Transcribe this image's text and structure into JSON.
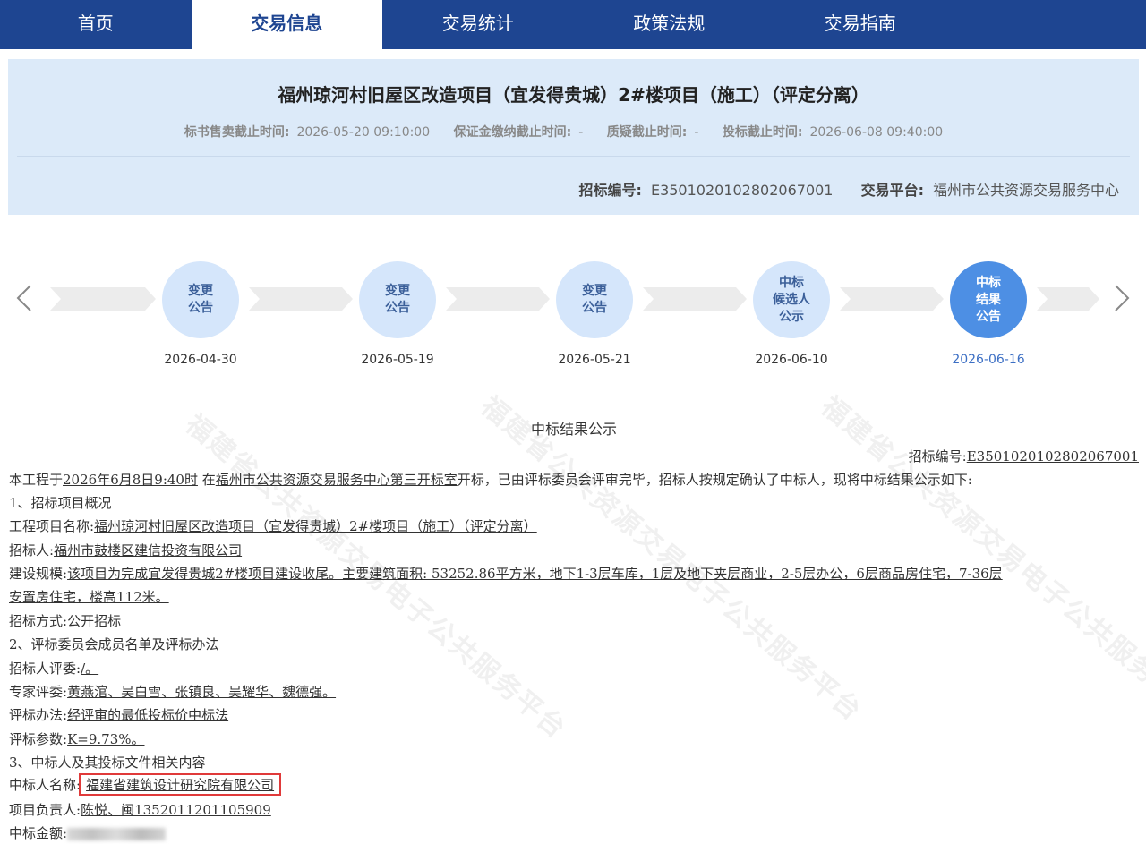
{
  "nav": {
    "items": [
      {
        "label": "首页",
        "active": false
      },
      {
        "label": "交易信息",
        "active": true
      },
      {
        "label": "交易统计",
        "active": false
      },
      {
        "label": "政策法规",
        "active": false
      },
      {
        "label": "交易指南",
        "active": false
      }
    ]
  },
  "project": {
    "title": "福州琼河村旧屋区改造项目（宜发得贵城）2#楼项目（施工）（评定分离）",
    "deadlines": [
      {
        "label": "标书售卖截止时间:",
        "value": "2026-05-20 09:10:00"
      },
      {
        "label": "保证金缴纳截止时间:",
        "value": "-"
      },
      {
        "label": "质疑截止时间:",
        "value": "-"
      },
      {
        "label": "投标截止时间:",
        "value": "2026-06-08 09:40:00"
      }
    ],
    "codes": [
      {
        "label": "招标编号:",
        "value": "E3501020102802067001"
      },
      {
        "label": "交易平台:",
        "value": "福州市公共资源交易服务中心"
      }
    ]
  },
  "timeline": {
    "nodes": [
      {
        "label": "变更\n公告",
        "date": "2026-04-30",
        "active": false
      },
      {
        "label": "变更\n公告",
        "date": "2026-05-19",
        "active": false
      },
      {
        "label": "变更\n公告",
        "date": "2026-05-21",
        "active": false
      },
      {
        "label": "中标\n候选人\n公示",
        "date": "2026-06-10",
        "active": false
      },
      {
        "label": "中标\n结果\n公告",
        "date": "2026-06-16",
        "active": true
      }
    ]
  },
  "notice": {
    "title": "中标结果公示",
    "ref_label": "招标编号:",
    "ref_value": "E3501020102802067001",
    "intro_prefix": "本工程于",
    "intro_time": "2026年6月8日9:40时",
    "intro_mid": " 在",
    "intro_place": "福州市公共资源交易服务中心第三开标室",
    "intro_suffix": "开标，已由评标委员会评审完毕，招标人按规定确认了中标人，现将中标结果公示如下:",
    "section1": "1、招标项目概况",
    "project_name_label": "工程项目名称:",
    "project_name_value": "福州琼河村旧屋区改造项目（宜发得贵城）2#楼项目（施工）（评定分离）",
    "tenderer_label": "招标人:",
    "tenderer_value": "福州市鼓楼区建信投资有限公司",
    "scale_label": "建设规模:",
    "scale_value_1": "该项目为完成宜发得贵城2#楼项目建设收尾。主要建筑面积: 53252.86平方米，地下1-3层车库，1层及地下夹层商业，2-5层办公，6层商品房住宅，7-36层",
    "scale_value_2": "安置房住宅，楼高112米。",
    "method_label": "招标方式:",
    "method_value": "公开招标",
    "section2": "2、评标委员会成员名单及评标办法",
    "owner_judge_label": "招标人评委:",
    "owner_judge_value": "/。",
    "expert_label": "专家评委:",
    "expert_value": "黄燕涫、吴白雪、张镇良、吴耀华、魏德强。",
    "eval_method_label": "评标办法:",
    "eval_method_value": "经评审的最低投标价中标法",
    "eval_param_label": "评标参数:",
    "eval_param_value": "K=9.73%。",
    "section3": "3、中标人及其投标文件相关内容",
    "winner_label": "中标人名称:",
    "winner_value": "福建省建筑设计研究院有限公司",
    "manager_label": "项目负责人:",
    "manager_value": "陈悦、闽1352011201105909",
    "amount_label": "中标金额:"
  },
  "watermark_text": "福建省公共资源交易电子公共服务平台",
  "colors": {
    "nav_bg": "#1e4591",
    "info_bg": "#dceaf9",
    "node_bg": "#d5e6fb",
    "node_active_bg": "#4d8fe4",
    "highlight_border": "#e03a3a"
  }
}
